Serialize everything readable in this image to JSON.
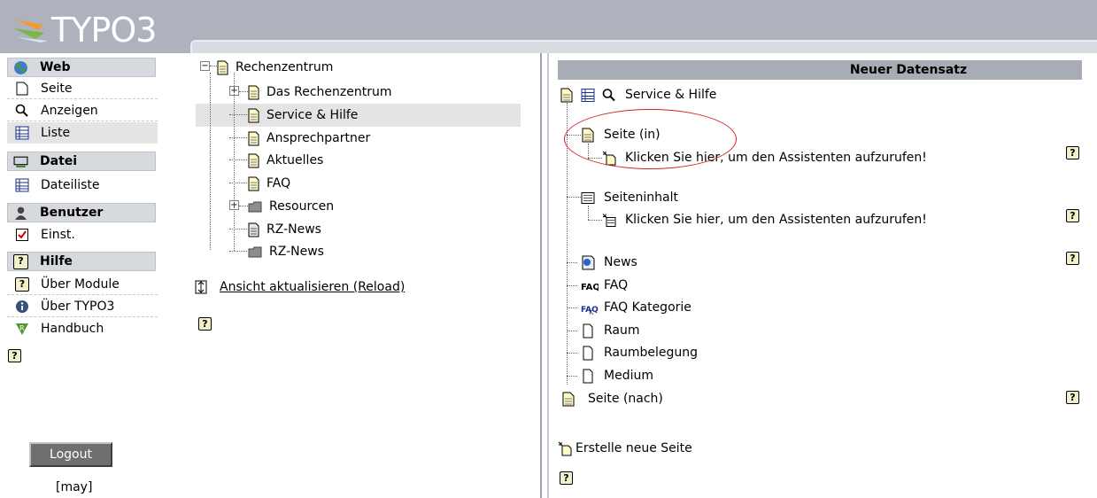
{
  "logo": {
    "text": "TYPO3"
  },
  "menu": {
    "groups": [
      {
        "label": "Web",
        "icon": "globe-icon"
      },
      {
        "label": "Datei",
        "icon": "drive-icon"
      },
      {
        "label": "Benutzer",
        "icon": "user-icon"
      },
      {
        "label": "Hilfe",
        "icon": "help-icon"
      }
    ],
    "items": {
      "seite": "Seite",
      "anzeigen": "Anzeigen",
      "liste": "Liste",
      "dateiliste": "Dateiliste",
      "einst": "Einst.",
      "ueber_module": "Über Module",
      "ueber_typo3": "Über TYPO3",
      "handbuch": "Handbuch"
    },
    "help_mark": "?",
    "logout_label": "Logout",
    "user": "[may]"
  },
  "tree": {
    "root": "Rechenzentrum",
    "children": [
      "Das Rechenzentrum",
      "Service & Hilfe",
      "Ansprechpartner",
      "Aktuelles",
      "FAQ",
      "Resourcen",
      "RZ-News",
      "RZ-News"
    ],
    "selected": "Service & Hilfe",
    "reload_label": "Ansicht aktualisieren (Reload)"
  },
  "panel": {
    "header": "Neuer Datensatz",
    "current_page": "Service & Hilfe",
    "seite_in": "Seite (in)",
    "wizard_1": "Klicken Sie hier, um den Assistenten aufzurufen!",
    "seiteninhalt": "Seiteninhalt",
    "wizard_2": "Klicken Sie hier, um den Assistenten aufzurufen!",
    "records": [
      "News",
      "FAQ",
      "FAQ Kategorie",
      "Raum",
      "Raumbelegung",
      "Medium"
    ],
    "seite_nach": "Seite (nach)",
    "create_new": "Erstelle neue Seite",
    "annotation_color": "#d8202a"
  }
}
